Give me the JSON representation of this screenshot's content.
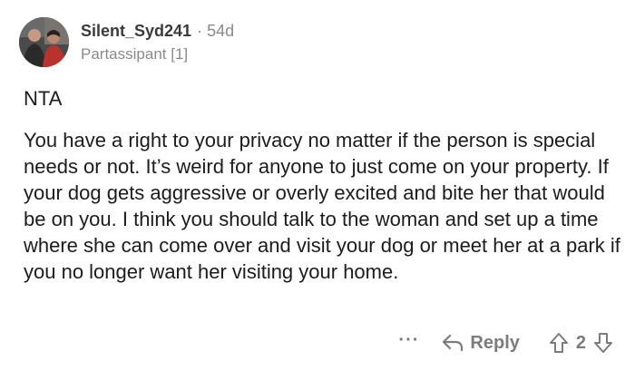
{
  "comment": {
    "author": {
      "username": "Silent_Syd241",
      "separator": "·",
      "age": "54d",
      "flair": "Partassipant [1]"
    },
    "body": {
      "verdict": "NTA",
      "paragraph": "You have a right to your privacy no matter if the person is special needs or not. It’s weird for anyone to just come on your property. If your dog gets aggressive or overly excited and bite her that would be on you. I think you should talk to the woman and set up a time where she can come over and visit your dog or meet her at a park if you no longer want her visiting your home."
    },
    "actions": {
      "more_label": "···",
      "reply_label": "Reply",
      "score": "2"
    }
  },
  "icons": {
    "avatar": "user-avatar",
    "reply": "reply-arrow-icon",
    "upvote": "upvote-arrow-icon",
    "downvote": "downvote-arrow-icon"
  },
  "colors": {
    "text_primary": "#1c1c1c",
    "text_muted": "#8a8a8a",
    "action_gray": "#7c7c7c",
    "background": "#ffffff"
  }
}
